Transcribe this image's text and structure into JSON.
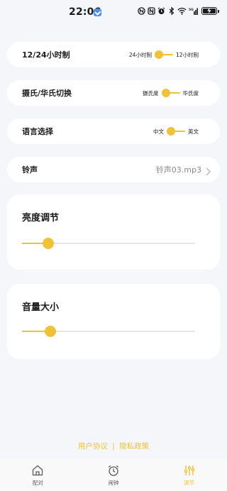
{
  "status_bar": {
    "time": "22:06",
    "icons": [
      "notification-badge-icon",
      "nfc-icon",
      "alarm-icon",
      "bluetooth-icon",
      "wifi-icon",
      "signal-icon",
      "battery-icon"
    ],
    "signal_label": "5G"
  },
  "settings": {
    "time_format": {
      "label": "12/24小时制",
      "option_left": "24小时制",
      "option_right": "12小时制"
    },
    "temperature": {
      "label": "摄氏/华氏切换",
      "option_left": "摄氏度",
      "option_right": "华氏度"
    },
    "language": {
      "label": "语言选择",
      "option_left": "中文",
      "option_right": "英文"
    },
    "ringtone": {
      "label": "铃声",
      "value": "铃声03.mp3"
    }
  },
  "brightness": {
    "title": "亮度调节",
    "level": 0.15
  },
  "volume": {
    "title": "音量大小",
    "level": 0.165
  },
  "footer": {
    "user_agreement": "用户协议",
    "separator": "|",
    "privacy_policy": "隐私政策"
  },
  "tabs": [
    {
      "label": "配对",
      "icon": "home-icon",
      "active": false
    },
    {
      "label": "闹钟",
      "icon": "alarm-clock-icon",
      "active": false
    },
    {
      "label": "调节",
      "icon": "sliders-icon",
      "active": true
    }
  ],
  "colors": {
    "accent": "#f0c237",
    "background": "#f5f6fa",
    "card": "#ffffff"
  }
}
